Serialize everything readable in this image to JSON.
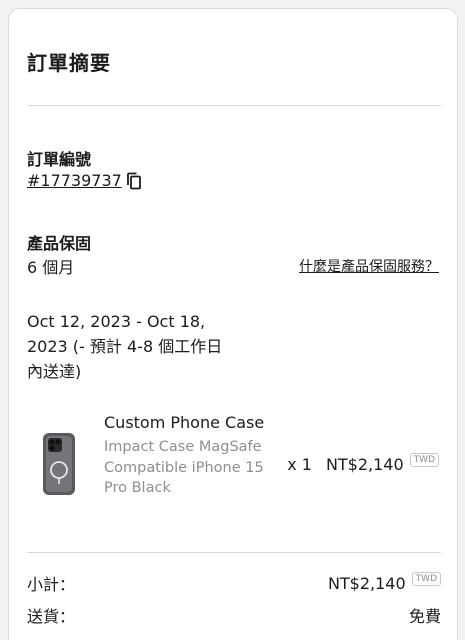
{
  "summary": {
    "title": "訂單摘要"
  },
  "order": {
    "label": "訂單編號",
    "number": "#17739737",
    "copy_icon": "copy-icon"
  },
  "warranty": {
    "label": "產品保固",
    "value": "6 個月",
    "link": "什麼是產品保固服務？"
  },
  "shipping_estimate": "Oct 12, 2023 - Oct 18, 2023 (- 預計 4-8 個工作日內送達)",
  "item": {
    "image_icon": "phone-case-image",
    "name": "Custom Phone Case",
    "description": "Impact Case MagSafe Compatible iPhone 15 Pro Black",
    "quantity": "x 1",
    "price": "NT$2,140",
    "currency": "TWD"
  },
  "totals": {
    "subtotal_label": "小計：",
    "subtotal_value": "NT$2,140",
    "subtotal_currency": "TWD",
    "shipping_label": "送貨：",
    "shipping_value": "免費"
  }
}
